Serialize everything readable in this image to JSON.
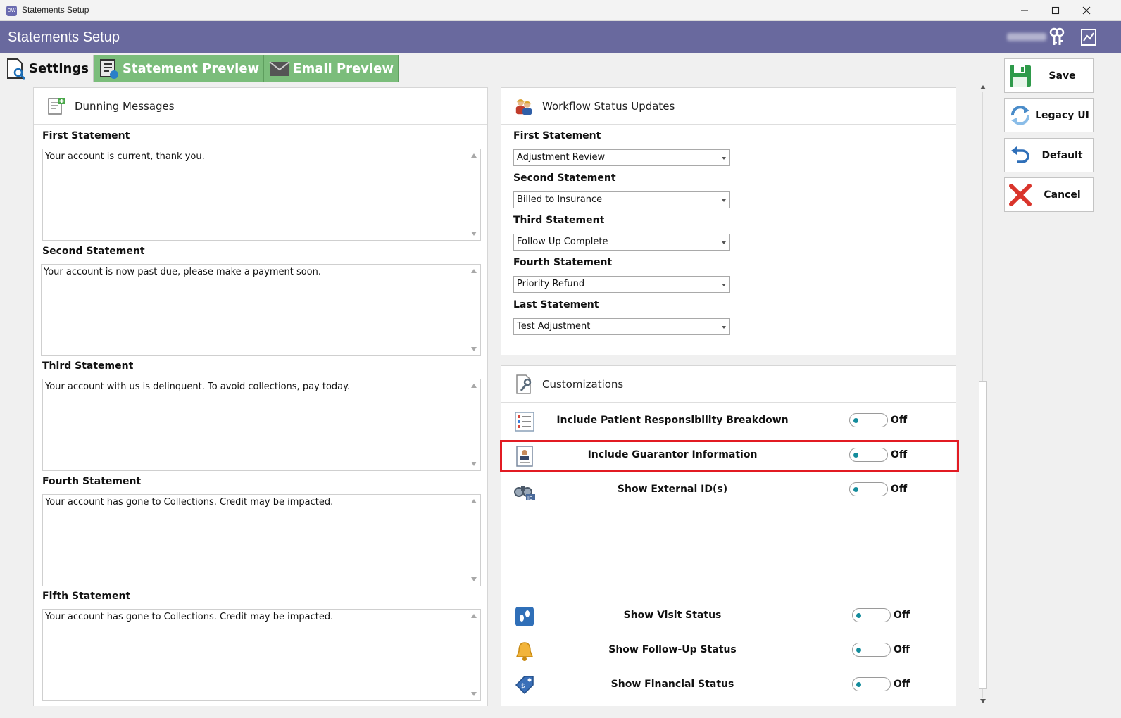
{
  "window": {
    "title": "Statements Setup",
    "app_icon_text": "DW"
  },
  "header": {
    "title": "Statements Setup"
  },
  "tabs": [
    {
      "label": "Settings",
      "active": true
    },
    {
      "label": "Statement Preview",
      "active": false
    },
    {
      "label": "Email Preview",
      "active": false
    }
  ],
  "dunning": {
    "title": "Dunning Messages",
    "items": [
      {
        "label": "First Statement",
        "message": "Your account is current, thank you."
      },
      {
        "label": "Second Statement",
        "message": "Your account is now past due, please make a payment soon."
      },
      {
        "label": "Third Statement",
        "message": "Your account with us is delinquent. To avoid collections, pay today."
      },
      {
        "label": "Fourth Statement",
        "message": "Your account has gone to Collections. Credit may be impacted."
      },
      {
        "label": "Fifth Statement",
        "message": "Your account has gone to Collections. Credit may be impacted."
      }
    ]
  },
  "workflow": {
    "title": "Workflow Status Updates",
    "items": [
      {
        "label": "First Statement",
        "value": "Adjustment Review"
      },
      {
        "label": "Second Statement",
        "value": "Billed to Insurance"
      },
      {
        "label": "Third Statement",
        "value": "Follow Up Complete"
      },
      {
        "label": "Fourth Statement",
        "value": "Priority Refund"
      },
      {
        "label": "Last Statement",
        "value": "Test Adjustment"
      }
    ]
  },
  "customizations": {
    "title": "Customizations",
    "items": [
      {
        "label": "Include Patient Responsibility Breakdown",
        "state": "Off",
        "icon": "checklist-icon"
      },
      {
        "label": "Include Guarantor Information",
        "state": "Off",
        "icon": "id-card-icon"
      },
      {
        "label": "Show External ID(s)",
        "state": "Off",
        "icon": "binoculars-icon"
      },
      {
        "label": "Show Visit Status",
        "state": "Off",
        "icon": "footprints-icon"
      },
      {
        "label": "Show Follow-Up Status",
        "state": "Off",
        "icon": "bell-icon"
      },
      {
        "label": "Show Financial Status",
        "state": "Off",
        "icon": "price-tag-icon"
      }
    ]
  },
  "actions": {
    "save": "Save",
    "legacy": "Legacy UI",
    "default": "Default",
    "cancel": "Cancel"
  },
  "colors": {
    "header_bg": "#69699e",
    "tab_inactive_bg": "#7bbd7b",
    "toggle_knob": "#148c9c",
    "highlight": "#e21b23"
  }
}
